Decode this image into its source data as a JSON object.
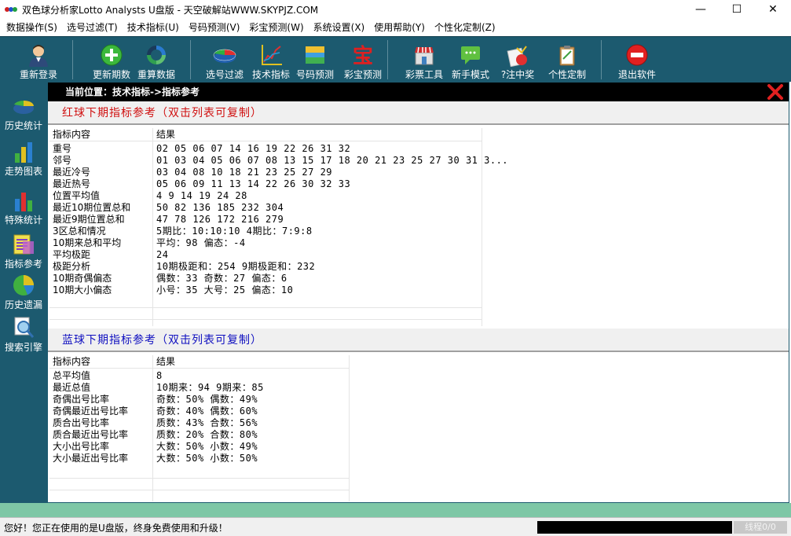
{
  "window": {
    "title": "双色球分析家Lotto Analysts U盘版 - 天空破解站WWW.SKYPJZ.COM",
    "minimize": "—",
    "maximize": "☐",
    "close": "✕"
  },
  "menu": [
    "数据操作(S)",
    "选号过滤(T)",
    "技术指标(U)",
    "号码预测(V)",
    "彩宝预测(W)",
    "系统设置(X)",
    "使用帮助(Y)",
    "个性化定制(Z)"
  ],
  "toolbar": {
    "login": "重新登录",
    "update": "更新期数",
    "recalc": "重算数据",
    "filter": "选号过滤",
    "tech": "技术指标",
    "predict": "号码预测",
    "caibao": "彩宝预测",
    "tools": "彩票工具",
    "novice": "新手模式",
    "winner": "?注中奖",
    "custom": "个性定制",
    "exit": "退出软件"
  },
  "sidebar": [
    "历史统计",
    "走势图表",
    "特殊统计",
    "指标参考",
    "历史遗漏",
    "搜索引擎"
  ],
  "location": "当前位置：技术指标->指标参考",
  "red": {
    "title": "红球下期指标参考（双击列表可复制）",
    "header": [
      "指标内容",
      "结果"
    ],
    "rows": [
      [
        "重号",
        "02 05 06 07 14 16 19 22 26 31 32"
      ],
      [
        "邻号",
        "01 03 04 05 06 07 08 13 15 17 18 20 21 23 25 27 30 31 3..."
      ],
      [
        "最近冷号",
        "03 04 08 10 18 21 23 25 27 29"
      ],
      [
        "最近热号",
        "05 06 09 11 13 14 22 26 30 32 33"
      ],
      [
        "位置平均值",
        "4 9 14 19 24 28"
      ],
      [
        "最近10期位置总和",
        "50 82 136 185 232 304"
      ],
      [
        "最近9期位置总和",
        "47 78 126 172 216 279"
      ],
      [
        "3区总和情况",
        "5期比：10:10:10 4期比：7:9:8"
      ],
      [
        "10期来总和平均",
        "平均：98 偏态：-4"
      ],
      [
        "平均极距",
        "24"
      ],
      [
        "极距分析",
        "10期极距和：254 9期极距和：232"
      ],
      [
        "10期奇偶偏态",
        "偶数：33  奇数：27  偏态：6"
      ],
      [
        "10期大小偏态",
        "小号：35  大号：25  偏态：10"
      ]
    ]
  },
  "blue": {
    "title": "蓝球下期指标参考（双击列表可复制）",
    "header": [
      "指标内容",
      "结果"
    ],
    "rows": [
      [
        "总平均值",
        "8"
      ],
      [
        "最近总值",
        "10期来：94    9期来：85"
      ],
      [
        "奇偶出号比率",
        "奇数：50%  偶数：49%"
      ],
      [
        "奇偶最近出号比率",
        "奇数：40%  偶数：60%"
      ],
      [
        "质合出号比率",
        "质数：43%  合数：56%"
      ],
      [
        "质合最近出号比率",
        "质数：20%  合数：80%"
      ],
      [
        "大小出号比率",
        "大数：50%  小数：49%"
      ],
      [
        "大小最近出号比率",
        "大数：50%  小数：50%"
      ]
    ]
  },
  "status": {
    "message": "您好！您正在使用的是U盘版，终身免费使用和升级！",
    "threads": "线程0/0"
  },
  "colors": {
    "toolbar_bg": "#1c5a6f",
    "red_title": "#d01010",
    "blue_title": "#1010c0",
    "status_green": "#7ec7a6"
  }
}
